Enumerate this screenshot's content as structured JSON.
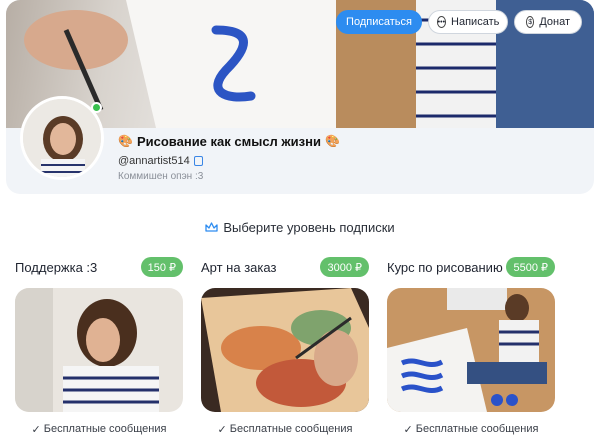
{
  "profile": {
    "name": "Рисование как смысл жизни",
    "handle": "@annartist514",
    "note": "Коммишен опэн :3",
    "online": true
  },
  "actions": {
    "subscribe_label": "Подписаться",
    "message_label": "Написать",
    "donate_label": "Донат"
  },
  "tiers_section": {
    "title": "Выберите уровень подписки"
  },
  "tiers": [
    {
      "name": "Поддержка :3",
      "price": "150 ₽",
      "feature": "Бесплатные сообщения"
    },
    {
      "name": "Арт на заказ",
      "price": "3000 ₽",
      "feature": "Бесплатные сообщения"
    },
    {
      "name": "Курс по рисованию",
      "price": "5500 ₽",
      "feature": "Бесплатные сообщения"
    }
  ],
  "colors": {
    "primary": "#2d8cf0",
    "price_badge": "#63c06b",
    "online": "#39c04d",
    "card_bg": "#f1f4f8"
  },
  "icons": {
    "palette": "palette-icon",
    "copy": "copy-icon",
    "chat": "chat-bubble-icon",
    "donate": "dollar-circle-icon",
    "crown": "crown-icon",
    "check": "check-icon"
  }
}
